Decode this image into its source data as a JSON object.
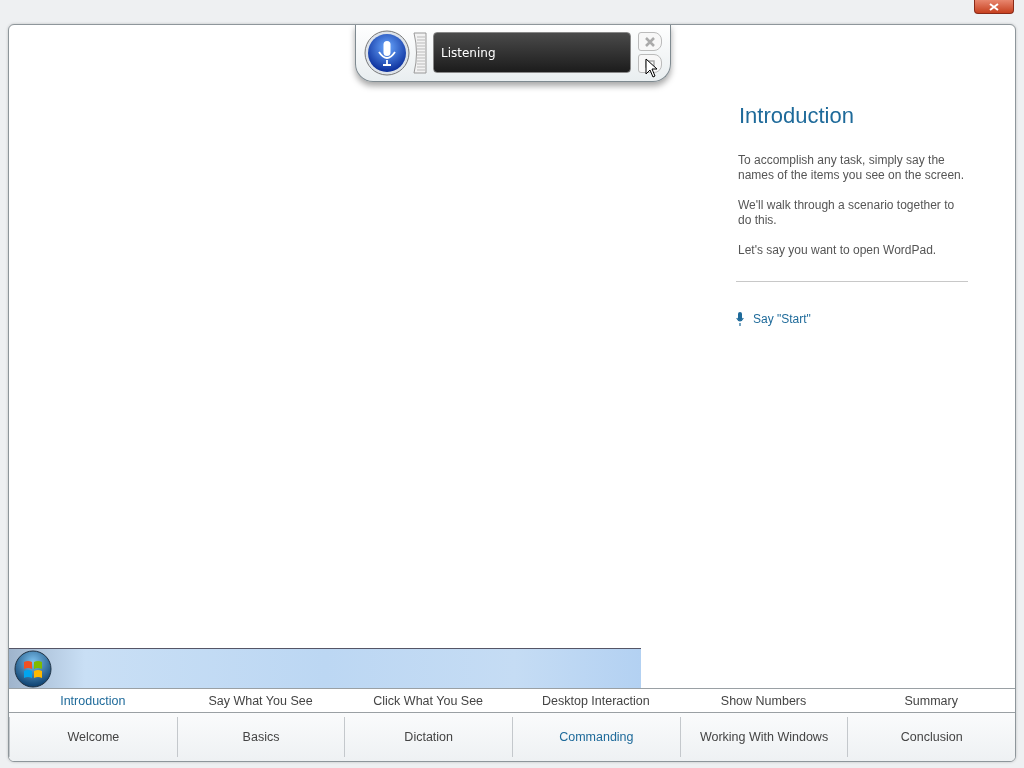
{
  "speech_bar": {
    "status": "Listening"
  },
  "lesson": {
    "title": "Introduction",
    "paragraphs": [
      "To accomplish any task, simply say the names of the items you see on the screen.",
      "We'll walk through a scenario together to do this.",
      "Let's say you want to open WordPad."
    ],
    "prompt": "Say \"Start\""
  },
  "sections": [
    {
      "label": "Introduction",
      "selected": true
    },
    {
      "label": "Say What You See",
      "selected": false
    },
    {
      "label": "Click What You See",
      "selected": false
    },
    {
      "label": "Desktop Interaction",
      "selected": false
    },
    {
      "label": "Show Numbers",
      "selected": false
    },
    {
      "label": "Summary",
      "selected": false
    }
  ],
  "chapters": [
    {
      "label": "Welcome",
      "selected": false
    },
    {
      "label": "Basics",
      "selected": false
    },
    {
      "label": "Dictation",
      "selected": false
    },
    {
      "label": "Commanding",
      "selected": true
    },
    {
      "label": "Working With Windows",
      "selected": false
    },
    {
      "label": "Conclusion",
      "selected": false
    }
  ]
}
